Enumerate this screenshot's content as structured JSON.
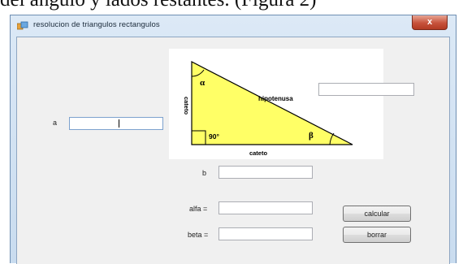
{
  "background_doc": {
    "text": "del ángulo y lados restantes. (Figura 2)"
  },
  "window": {
    "title": "resolucion de triangulos rectangulos",
    "close_label": "x"
  },
  "labels": {
    "a": "a",
    "b": "b",
    "alfa": "alfa =",
    "beta": "beta ="
  },
  "fields": {
    "a_value": "",
    "b_value": "",
    "hipotenusa_value": "",
    "alfa_value": "",
    "beta_value": ""
  },
  "buttons": {
    "calcular": "calcular",
    "borrar": "borrar"
  },
  "diagram": {
    "alpha": "α",
    "beta": "β",
    "right_angle": "90°",
    "hipotenusa": "hipotenusa",
    "cateto_vertical": "cateto",
    "cateto_horizontal": "cateto",
    "fill_color": "#ffff66"
  }
}
